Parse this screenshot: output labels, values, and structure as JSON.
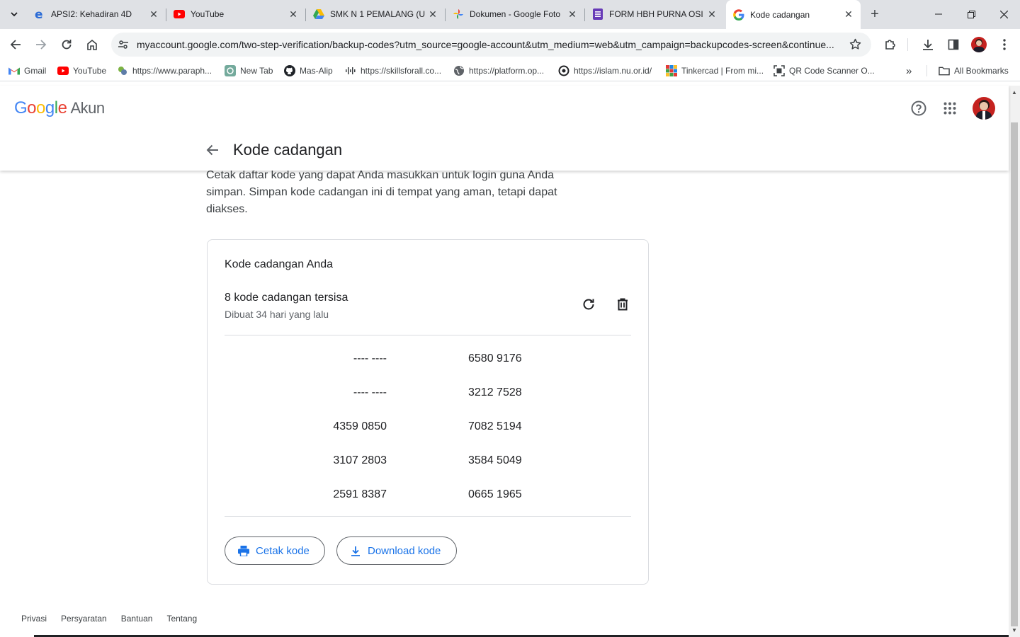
{
  "browser": {
    "tabs": [
      {
        "title": "APSI2: Kehadiran 4D",
        "icon": "edge-e-icon"
      },
      {
        "title": "YouTube",
        "icon": "youtube-icon"
      },
      {
        "title": "SMK N 1 PEMALANG (U",
        "icon": "google-drive-icon"
      },
      {
        "title": "Dokumen - Google Foto",
        "icon": "google-photos-icon"
      },
      {
        "title": "FORM HBH PURNA OSI",
        "icon": "google-forms-icon"
      },
      {
        "title": "Kode cadangan",
        "icon": "google-g-icon",
        "active": true
      }
    ],
    "new_tab": "+",
    "url": "myaccount.google.com/two-step-verification/backup-codes?utm_source=google-account&utm_medium=web&utm_campaign=backupcodes-screen&continue...",
    "bookmarks": [
      {
        "label": "Gmail",
        "icon": "gmail-icon"
      },
      {
        "label": "YouTube",
        "icon": "youtube-icon"
      },
      {
        "label": "https://www.paraph...",
        "icon": "paraphrase-icon"
      },
      {
        "label": "New Tab",
        "icon": "openai-icon"
      },
      {
        "label": "Mas-Alip",
        "icon": "github-icon"
      },
      {
        "label": "https://skillsforall.co...",
        "icon": "skillsforall-icon"
      },
      {
        "label": "https://platform.op...",
        "icon": "globe-icon"
      },
      {
        "label": "https://islam.nu.or.id/",
        "icon": "nu-icon"
      },
      {
        "label": "Tinkercad | From mi...",
        "icon": "tinkercad-icon"
      },
      {
        "label": "QR Code Scanner O...",
        "icon": "qr-icon"
      }
    ],
    "more_bookmarks": "»",
    "all_bookmarks": "All Bookmarks"
  },
  "header": {
    "logo_google": "Google",
    "logo_product": "Akun"
  },
  "page": {
    "title": "Kode cadangan",
    "description": "Cetak daftar kode yang dapat Anda masukkan untuk login guna Anda simpan. Simpan kode cadangan ini di tempat yang aman, tetapi dapat diakses."
  },
  "card": {
    "title": "Kode cadangan Anda",
    "remaining": "8 kode cadangan tersisa",
    "created": "Dibuat 34 hari yang lalu",
    "codes_left": [
      "---- ----",
      "---- ----",
      "4359 0850",
      "3107 2803",
      "2591 8387"
    ],
    "codes_right": [
      "6580 9176",
      "3212 7528",
      "7082 5194",
      "3584 5049",
      "0665 1965"
    ],
    "print_button": "Cetak kode",
    "download_button": "Download kode"
  },
  "footer": {
    "links": [
      "Privasi",
      "Persyaratan",
      "Bantuan",
      "Tentang"
    ]
  },
  "colors": {
    "accent": "#1a73e8",
    "google_blue": "#4285f4",
    "google_red": "#ea4335",
    "google_yellow": "#fbbc05",
    "google_green": "#34a853"
  }
}
